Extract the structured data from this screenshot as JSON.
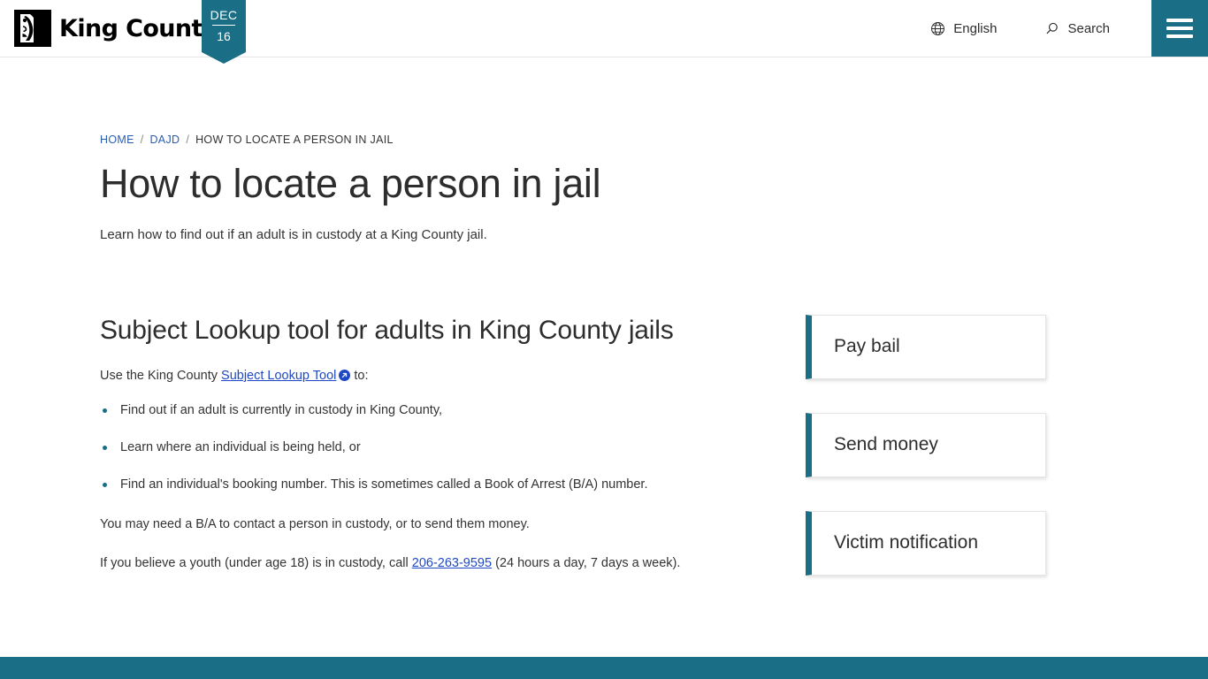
{
  "header": {
    "logo": {
      "icon": "king-county-portrait-logo",
      "wordmark": "King County"
    },
    "date_badge": {
      "month": "DEC",
      "day": "16"
    },
    "language": {
      "icon": "globe-icon",
      "label": "English"
    },
    "search": {
      "icon": "search-icon",
      "label": "Search"
    },
    "menu": {
      "icon": "hamburger-menu-icon",
      "label": "Menu"
    }
  },
  "breadcrumb": {
    "items": [
      {
        "label": "HOME",
        "link": true
      },
      {
        "label": "DAJD",
        "link": true
      },
      {
        "label": "HOW TO LOCATE A PERSON IN JAIL",
        "link": false
      }
    ],
    "separator": "/"
  },
  "page": {
    "title": "How to locate a person in jail",
    "summary": "Learn how to find out if an adult is in custody at a King County jail."
  },
  "main": {
    "section_title": "Subject Lookup tool for adults in King County jails",
    "intro": {
      "before_link": "Use the King County ",
      "link_text": "Subject Lookup Tool",
      "link_icon": "external-link-icon",
      "after_link": " to:"
    },
    "bullets": [
      "Find out if an adult is currently in custody in King County,",
      "Learn where an individual is being held, or",
      "Find an individual's booking number. This is sometimes called a Book of Arrest (B/A) number."
    ],
    "paragraphs": [
      {
        "text": "You may need a B/A to contact a person in custody, or to send them money."
      },
      {
        "before_link": "If you believe a youth (under age 18) is in custody, call ",
        "link_text": "206-263-9595",
        "after_link": " (24 hours a day, 7 days a week)."
      }
    ]
  },
  "sidebar": {
    "cards": [
      {
        "label": "Pay bail"
      },
      {
        "label": "Send money"
      },
      {
        "label": "Victim notification"
      }
    ]
  },
  "colors": {
    "teal": "#1a6e85",
    "link_blue": "#1f49c4",
    "breadcrumb_blue": "#2a5db0",
    "text": "#333333"
  }
}
